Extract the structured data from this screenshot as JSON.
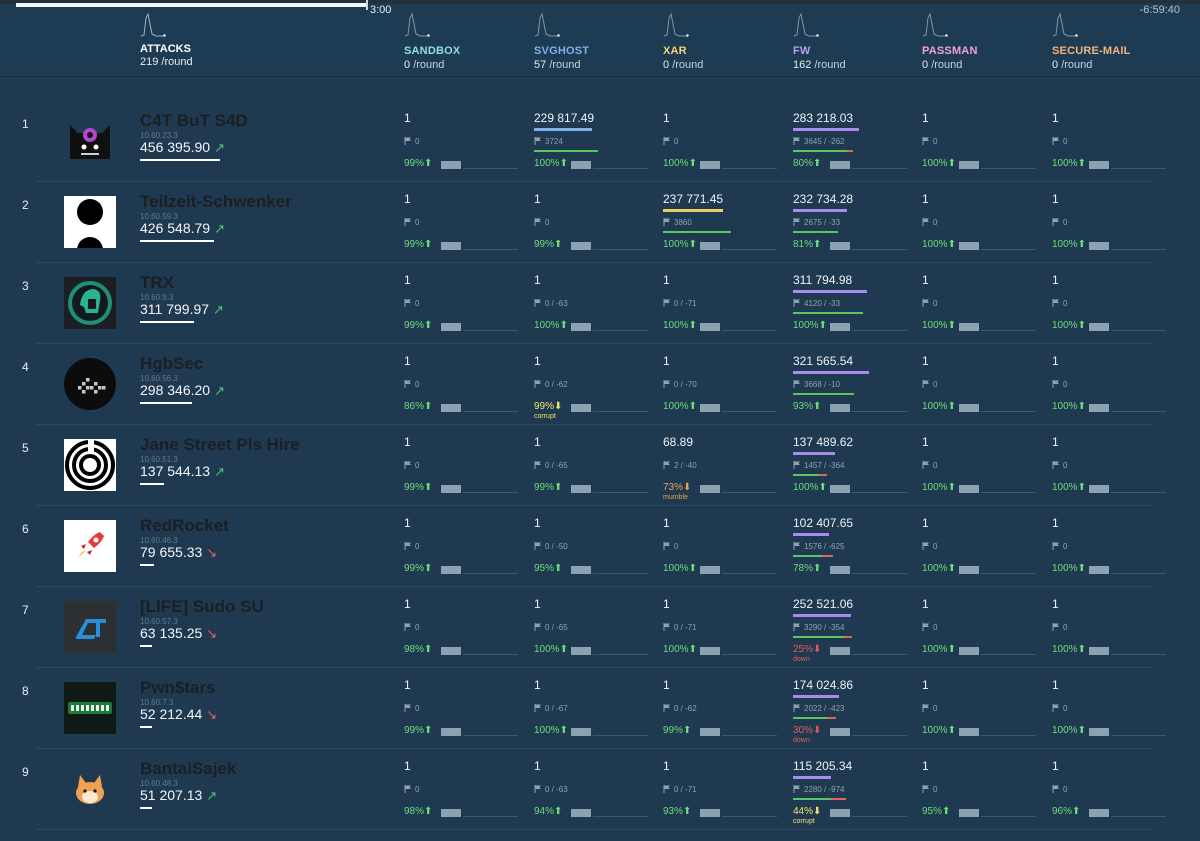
{
  "timer": {
    "elapsed": "3:00",
    "remaining": "-6:59:40"
  },
  "colors": {
    "background": "#1f3a50",
    "header": "#1d3b52",
    "sla_good": "#6ddd7a",
    "sla_warn": "#f3e36c",
    "sla_bad": "#e55a5a",
    "trend_up": "#4ec27c",
    "trend_down": "#e26060"
  },
  "icons": {
    "flag": "flag-icon",
    "trend_up": "arrow-up-right-icon",
    "trend_down": "arrow-down-right-icon",
    "sla_up": "arrow-up-icon",
    "sla_down": "arrow-down-icon",
    "sparkline": "sparkline-icon"
  },
  "header": {
    "attacks": {
      "label": "ATTACKS",
      "rate": "219",
      "unit": "/round"
    },
    "services": [
      {
        "name": "SANDBOX",
        "rate": "0",
        "unit": "/round",
        "color": "#8fdfe4"
      },
      {
        "name": "SVGHOST",
        "rate": "57",
        "unit": "/round",
        "color": "#7fb0ea"
      },
      {
        "name": "XAR",
        "rate": "0",
        "unit": "/round",
        "color": "#f0d27a"
      },
      {
        "name": "FW",
        "rate": "162",
        "unit": "/round",
        "color": "#c29bf2"
      },
      {
        "name": "PASSMAN",
        "rate": "0",
        "unit": "/round",
        "color": "#f2a2d6"
      },
      {
        "name": "SECURE-MAIL",
        "rate": "0",
        "unit": "/round",
        "color": "#f5b47c"
      }
    ]
  },
  "teams": [
    {
      "rank": "1",
      "name": "C4T BuT S4D",
      "ip": "10.60.23.3",
      "score": "456 395.90",
      "trend": "up",
      "score_frac": 1.0,
      "logo": "cat-logo",
      "services": [
        {
          "points": "1",
          "flags": "0",
          "sla": "99%",
          "sla_status": "good",
          "note": ""
        },
        {
          "points": "229 817.49",
          "flags": "3724",
          "sla": "100%",
          "sla_status": "good",
          "note": "",
          "points_frac": 0.72,
          "got_frac": 0.85,
          "lost_frac": 0
        },
        {
          "points": "1",
          "flags": "0",
          "sla": "100%",
          "sla_status": "good",
          "note": ""
        },
        {
          "points": "283 218.03",
          "flags": "3645 / -262",
          "sla": "80%",
          "sla_status": "good",
          "note": "",
          "points_frac": 0.82,
          "got_frac": 0.72,
          "lost_frac": 0.08
        },
        {
          "points": "1",
          "flags": "0",
          "sla": "100%",
          "sla_status": "good",
          "note": ""
        },
        {
          "points": "1",
          "flags": "0",
          "sla": "100%",
          "sla_status": "good",
          "note": ""
        }
      ]
    },
    {
      "rank": "2",
      "name": "Teilzeit-Schwenker",
      "ip": "10.60.59.3",
      "score": "426 548.79",
      "trend": "up",
      "score_frac": 0.93,
      "logo": "circles-logo",
      "services": [
        {
          "points": "1",
          "flags": "0",
          "sla": "99%",
          "sla_status": "good",
          "note": ""
        },
        {
          "points": "1",
          "flags": "0",
          "sla": "99%",
          "sla_status": "good",
          "note": ""
        },
        {
          "points": "237 771.45",
          "flags": "3860",
          "sla": "100%",
          "sla_status": "good",
          "note": "",
          "points_frac": 0.75,
          "got_frac": 0.9,
          "lost_frac": 0
        },
        {
          "points": "232 734.28",
          "flags": "2675 / -33",
          "sla": "81%",
          "sla_status": "good",
          "note": "",
          "points_frac": 0.68,
          "got_frac": 0.6,
          "lost_frac": 0
        },
        {
          "points": "1",
          "flags": "0",
          "sla": "100%",
          "sla_status": "good",
          "note": ""
        },
        {
          "points": "1",
          "flags": "0",
          "sla": "100%",
          "sla_status": "good",
          "note": ""
        }
      ]
    },
    {
      "rank": "3",
      "name": "TRX",
      "ip": "10.60.9.3",
      "score": "311 799.97",
      "trend": "up",
      "score_frac": 0.68,
      "logo": "spartan-logo",
      "services": [
        {
          "points": "1",
          "flags": "0",
          "sla": "99%",
          "sla_status": "good",
          "note": ""
        },
        {
          "points": "1",
          "flags": "0 / -63",
          "sla": "100%",
          "sla_status": "good",
          "note": ""
        },
        {
          "points": "1",
          "flags": "0 / -71",
          "sla": "100%",
          "sla_status": "good",
          "note": ""
        },
        {
          "points": "311 794.98",
          "flags": "4120 / -33",
          "sla": "100%",
          "sla_status": "good",
          "note": "",
          "points_frac": 0.92,
          "got_frac": 0.93,
          "lost_frac": 0
        },
        {
          "points": "1",
          "flags": "0",
          "sla": "100%",
          "sla_status": "good",
          "note": ""
        },
        {
          "points": "1",
          "flags": "0",
          "sla": "100%",
          "sla_status": "good",
          "note": ""
        }
      ]
    },
    {
      "rank": "4",
      "name": "HgbSec",
      "ip": "10.60.56.3",
      "score": "298 346.20",
      "trend": "up",
      "score_frac": 0.65,
      "logo": "blocks-logo",
      "services": [
        {
          "points": "1",
          "flags": "0",
          "sla": "86%",
          "sla_status": "good",
          "note": ""
        },
        {
          "points": "1",
          "flags": "0 / -62",
          "sla": "99%",
          "sla_status": "warn",
          "note": "corrupt"
        },
        {
          "points": "1",
          "flags": "0 / -70",
          "sla": "100%",
          "sla_status": "good",
          "note": ""
        },
        {
          "points": "321 565.54",
          "flags": "3668 / -10",
          "sla": "93%",
          "sla_status": "good",
          "note": "",
          "points_frac": 0.95,
          "got_frac": 0.82,
          "lost_frac": 0
        },
        {
          "points": "1",
          "flags": "0",
          "sla": "100%",
          "sla_status": "good",
          "note": ""
        },
        {
          "points": "1",
          "flags": "0",
          "sla": "100%",
          "sla_status": "good",
          "note": ""
        }
      ]
    },
    {
      "rank": "5",
      "name": "Jane Street Pls Hire",
      "ip": "10.60.51.3",
      "score": "137 544.13",
      "trend": "up",
      "score_frac": 0.3,
      "logo": "spiral-logo",
      "services": [
        {
          "points": "1",
          "flags": "0",
          "sla": "99%",
          "sla_status": "good",
          "note": ""
        },
        {
          "points": "1",
          "flags": "0 / -65",
          "sla": "99%",
          "sla_status": "good",
          "note": ""
        },
        {
          "points": "68.89",
          "flags": "2 / -40",
          "sla": "73%",
          "sla_status": "orange",
          "note": "mumble"
        },
        {
          "points": "137 489.62",
          "flags": "1457 / -364",
          "sla": "100%",
          "sla_status": "good",
          "note": "",
          "points_frac": 0.52,
          "got_frac": 0.35,
          "lost_frac": 0.1
        },
        {
          "points": "1",
          "flags": "0",
          "sla": "100%",
          "sla_status": "good",
          "note": ""
        },
        {
          "points": "1",
          "flags": "0",
          "sla": "100%",
          "sla_status": "good",
          "note": ""
        }
      ]
    },
    {
      "rank": "6",
      "name": "RedRocket",
      "ip": "10.60.46.3",
      "score": "79 655.33",
      "trend": "down",
      "score_frac": 0.17,
      "logo": "rocket-logo",
      "services": [
        {
          "points": "1",
          "flags": "0",
          "sla": "99%",
          "sla_status": "good",
          "note": ""
        },
        {
          "points": "1",
          "flags": "0 / -50",
          "sla": "95%",
          "sla_status": "good",
          "note": ""
        },
        {
          "points": "1",
          "flags": "0",
          "sla": "100%",
          "sla_status": "good",
          "note": ""
        },
        {
          "points": "102 407.65",
          "flags": "1576 / -625",
          "sla": "78%",
          "sla_status": "good",
          "note": "",
          "points_frac": 0.45,
          "got_frac": 0.38,
          "lost_frac": 0.15
        },
        {
          "points": "1",
          "flags": "0",
          "sla": "100%",
          "sla_status": "good",
          "note": ""
        },
        {
          "points": "1",
          "flags": "0",
          "sla": "100%",
          "sla_status": "good",
          "note": ""
        }
      ]
    },
    {
      "rank": "7",
      "name": "[LIFE] Sudo SU",
      "ip": "10.60.57.3",
      "score": "63 135.25",
      "trend": "down",
      "score_frac": 0.14,
      "logo": "lt-logo",
      "services": [
        {
          "points": "1",
          "flags": "0",
          "sla": "98%",
          "sla_status": "good",
          "note": ""
        },
        {
          "points": "1",
          "flags": "0 / -65",
          "sla": "100%",
          "sla_status": "good",
          "note": ""
        },
        {
          "points": "1",
          "flags": "0 / -71",
          "sla": "100%",
          "sla_status": "good",
          "note": ""
        },
        {
          "points": "252 521.06",
          "flags": "3290 / -354",
          "sla": "25%",
          "sla_status": "bad",
          "note": "down",
          "points_frac": 0.72,
          "got_frac": 0.68,
          "lost_frac": 0.1
        },
        {
          "points": "1",
          "flags": "0",
          "sla": "100%",
          "sla_status": "good",
          "note": ""
        },
        {
          "points": "1",
          "flags": "0",
          "sla": "100%",
          "sla_status": "good",
          "note": ""
        }
      ]
    },
    {
      "rank": "8",
      "name": "Pwn$tars",
      "ip": "10.60.7.3",
      "score": "52 212.44",
      "trend": "down",
      "score_frac": 0.11,
      "logo": "pwnstars-logo",
      "services": [
        {
          "points": "1",
          "flags": "0",
          "sla": "99%",
          "sla_status": "good",
          "note": ""
        },
        {
          "points": "1",
          "flags": "0 / -67",
          "sla": "100%",
          "sla_status": "good",
          "note": ""
        },
        {
          "points": "1",
          "flags": "0 / -62",
          "sla": "99%",
          "sla_status": "good",
          "note": ""
        },
        {
          "points": "174 024.86",
          "flags": "2022 / -423",
          "sla": "30%",
          "sla_status": "bad",
          "note": "down",
          "points_frac": 0.58,
          "got_frac": 0.45,
          "lost_frac": 0.12
        },
        {
          "points": "1",
          "flags": "0",
          "sla": "100%",
          "sla_status": "good",
          "note": ""
        },
        {
          "points": "1",
          "flags": "0",
          "sla": "100%",
          "sla_status": "good",
          "note": ""
        }
      ]
    },
    {
      "rank": "9",
      "name": "BantaiSajek",
      "ip": "10.60.48.3",
      "score": "51 207.13",
      "trend": "up",
      "score_frac": 0.11,
      "logo": "shiba-logo",
      "services": [
        {
          "points": "1",
          "flags": "0",
          "sla": "98%",
          "sla_status": "good",
          "note": ""
        },
        {
          "points": "1",
          "flags": "0 / -63",
          "sla": "94%",
          "sla_status": "good",
          "note": ""
        },
        {
          "points": "1",
          "flags": "0 / -71",
          "sla": "93%",
          "sla_status": "good",
          "note": ""
        },
        {
          "points": "115 205.34",
          "flags": "2280 / -974",
          "sla": "44%",
          "sla_status": "warn",
          "note": "corrupt",
          "points_frac": 0.48,
          "got_frac": 0.5,
          "lost_frac": 0.2
        },
        {
          "points": "1",
          "flags": "0",
          "sla": "95%",
          "sla_status": "good",
          "note": ""
        },
        {
          "points": "1",
          "flags": "0",
          "sla": "96%",
          "sla_status": "good",
          "note": ""
        }
      ]
    }
  ]
}
